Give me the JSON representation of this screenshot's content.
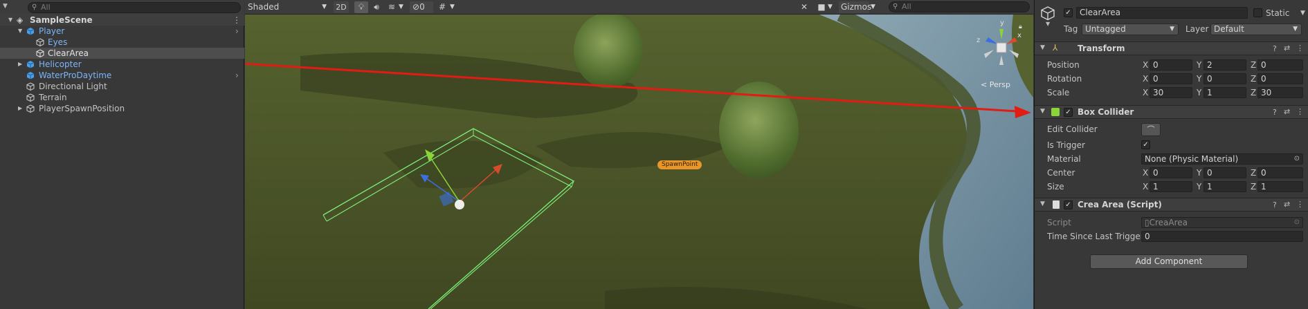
{
  "hierarchy": {
    "search_placeholder": "All",
    "scene_name": "SampleScene",
    "items": [
      {
        "label": "Player"
      },
      {
        "label": "Eyes"
      },
      {
        "label": "ClearArea"
      },
      {
        "label": "Helicopter"
      },
      {
        "label": "WaterProDaytime"
      },
      {
        "label": "Directional Light"
      },
      {
        "label": "Terrain"
      },
      {
        "label": "PlayerSpawnPosition"
      }
    ]
  },
  "scene": {
    "shading_mode": "Shaded",
    "btn_2d": "2D",
    "hidden_count": "0",
    "gizmos_label": "Gizmos",
    "search_placeholder": "All",
    "persp_label": "Persp",
    "spawn_label": "SpawnPoint",
    "axis_y": "y",
    "axis_x": "x",
    "axis_z": "z"
  },
  "inspector": {
    "object_name": "ClearArea",
    "static_label": "Static",
    "tag_label": "Tag",
    "tag_value": "Untagged",
    "layer_label": "Layer",
    "layer_value": "Default",
    "axis_x": "X",
    "axis_y": "Y",
    "axis_z": "Z",
    "transform": {
      "title": "Transform",
      "position_label": "Position",
      "rotation_label": "Rotation",
      "scale_label": "Scale",
      "position": {
        "x": "0",
        "y": "2",
        "z": "0"
      },
      "rotation": {
        "x": "0",
        "y": "0",
        "z": "0"
      },
      "scale": {
        "x": "30",
        "y": "1",
        "z": "30"
      }
    },
    "box_collider": {
      "title": "Box Collider",
      "edit_collider_label": "Edit Collider",
      "is_trigger_label": "Is Trigger",
      "material_label": "Material",
      "material_value": "None (Physic Material)",
      "center_label": "Center",
      "size_label": "Size",
      "center": {
        "x": "0",
        "y": "0",
        "z": "0"
      },
      "size": {
        "x": "1",
        "y": "1",
        "z": "1"
      }
    },
    "script_component": {
      "title": "Crea Area (Script)",
      "script_label": "Script",
      "script_value": "CreaArea",
      "time_label": "Time Since Last Trigger",
      "time_value": "0"
    },
    "add_component": "Add Component"
  }
}
